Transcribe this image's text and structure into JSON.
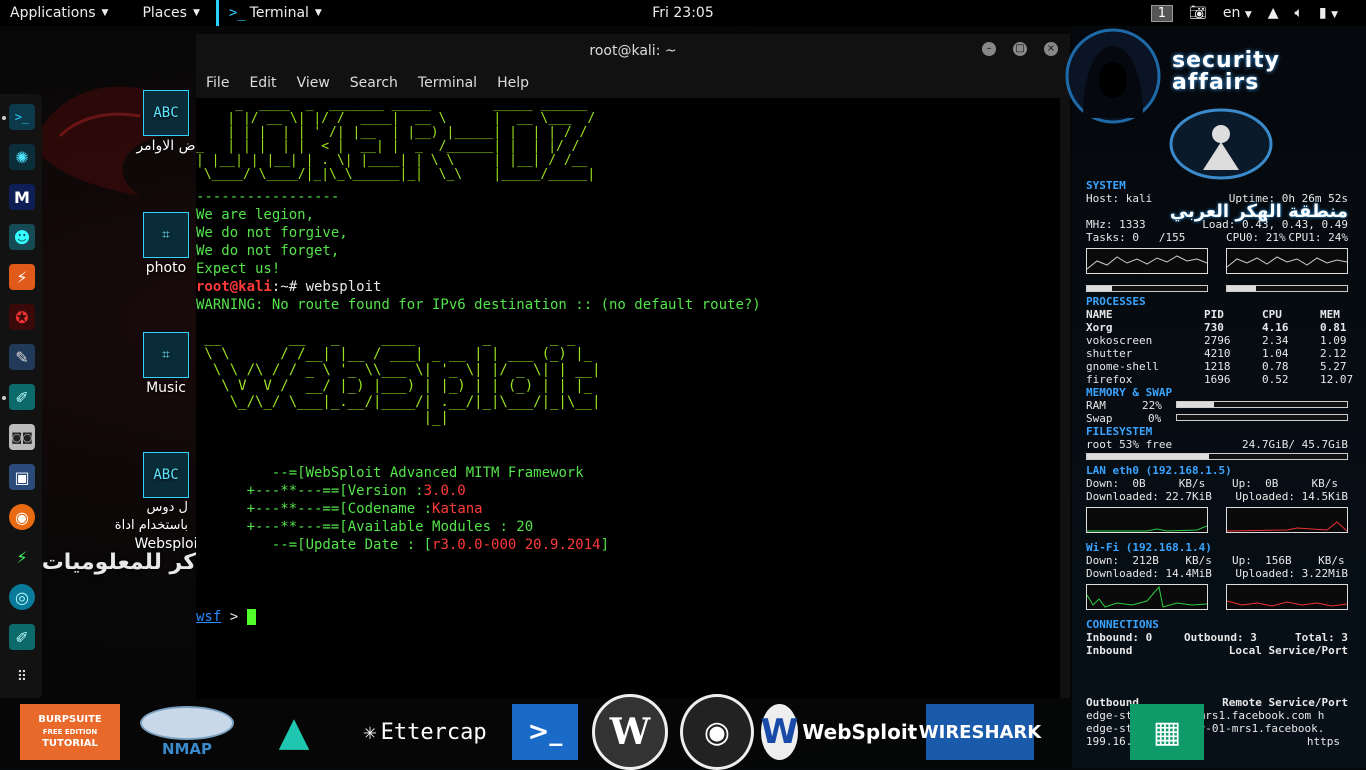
{
  "topbar": {
    "applications": "Applications",
    "places": "Places",
    "terminal": "Terminal",
    "clock": "Fri 23:05",
    "workspace": "1",
    "lang": "en"
  },
  "desktop": {
    "icons": [
      {
        "label": "ض الاوامر",
        "glyph": "ABC"
      },
      {
        "label": "photo",
        "glyph": ""
      },
      {
        "label": "Music",
        "glyph": ""
      },
      {
        "label": "Websploi",
        "glyph": "ABC"
      }
    ],
    "arabic_text_1": "ل دوس",
    "arabic_text_2": "باستخدام اداة",
    "arabic_text_3": "كر للمعلوميات"
  },
  "terminal": {
    "title": "root@kali: ~",
    "menu": [
      "File",
      "Edit",
      "View",
      "Search",
      "Terminal",
      "Help"
    ],
    "separator": "-----------------",
    "motto": [
      "We are legion,",
      "We do not forgive,",
      "We do not forget,",
      "Expect us!"
    ],
    "prompt_user": "root@kali",
    "prompt_rest": ":~# websploit",
    "warning": "WARNING: No route found for IPv6 destination :: (no default route?)",
    "info_prefix_1": "--=[",
    "info_line_1": "WebSploit Advanced MITM Framework",
    "info_prefix": "+---**---==[",
    "version_label": "Version :",
    "version": "3.0.0",
    "codename_label": "Codename :",
    "codename": "Katana",
    "modules": "Available Modules : 20",
    "update_prefix": "--=[",
    "update_label": "Update Date : [",
    "update_value": "r3.0.0-000 20.9.2014",
    "update_end": "]",
    "wsf_prompt": "wsf",
    "wsf_arrow": " > "
  },
  "conky": {
    "brand": "security affairs",
    "system_title": "SYSTEM",
    "host": "Host: kali",
    "uptime": "Uptime: 0h 26m 52s",
    "mhz": "MHz: 1333",
    "load": "Load: 0.43, 0.43, 0.49",
    "tasks": "Tasks: 0   /155",
    "cpu0": "CPU0: 21%",
    "cpu1": "CPU1: 24%",
    "processes_title": "PROCESSES",
    "proc_header": [
      "NAME",
      "PID",
      "CPU",
      "MEM"
    ],
    "procs": [
      [
        "Xorg",
        "730",
        "4.16",
        "0.81"
      ],
      [
        "vokoscreen",
        "2796",
        "2.34",
        "1.09"
      ],
      [
        "shutter",
        "4210",
        "1.04",
        "2.12"
      ],
      [
        "gnome-shell",
        "1218",
        "0.78",
        "5.27"
      ],
      [
        "firefox",
        "1696",
        "0.52",
        "12.07"
      ]
    ],
    "memory_title": "MEMORY & SWAP",
    "ram_label": "RAM",
    "ram_pct": "22%",
    "ram_fraction": 0.22,
    "swap_label": "Swap",
    "swap_pct": "0%",
    "filesystem_title": "FILESYSTEM",
    "root_free": "root 53% free",
    "root_size": "24.7GiB/ 45.7GiB",
    "lan_title": "LAN eth0 (192.168.1.5)",
    "lan_down": "Down:  0B     KB/s",
    "lan_up": "Up:  0B     KB/s",
    "lan_downloaded": "Downloaded: 22.7KiB",
    "lan_uploaded": "Uploaded: 14.5KiB",
    "wifi_title": "Wi-Fi (192.168.1.4)",
    "wifi_down": "Down:  212B    KB/s",
    "wifi_up": "Up:  156B    KB/s",
    "wifi_downloaded": "Downloaded: 14.4MiB",
    "wifi_uploaded": "Uploaded: 3.22MiB",
    "connections_title": "CONNECTIONS",
    "inbound": "Inbound: 0",
    "outbound": "Outbound: 3",
    "total": "Total: 3",
    "inbound_label": "Inbound",
    "local_service": "Local Service/Port",
    "outbound_label": "Outbound",
    "remote_service": "Remote Service/Port",
    "remote_1": "edge-star-shv-01-mrs1.facebook.com h",
    "remote_2": "edge-star-mini-shv-01-mrs1.facebook.",
    "remote_3": "199.16.156.201",
    "remote_3b": "https",
    "arabic_overlay": "منطقة الهكر العربي"
  },
  "apps": {
    "burp_1": "BURPSUITE",
    "burp_2": "FREE EDITION",
    "burp_3": "TUTORIAL",
    "nmap": "NMAP",
    "ettercap": "Ettercap",
    "websploit": "WebSploit",
    "wireshark": "WIRESHARK"
  }
}
